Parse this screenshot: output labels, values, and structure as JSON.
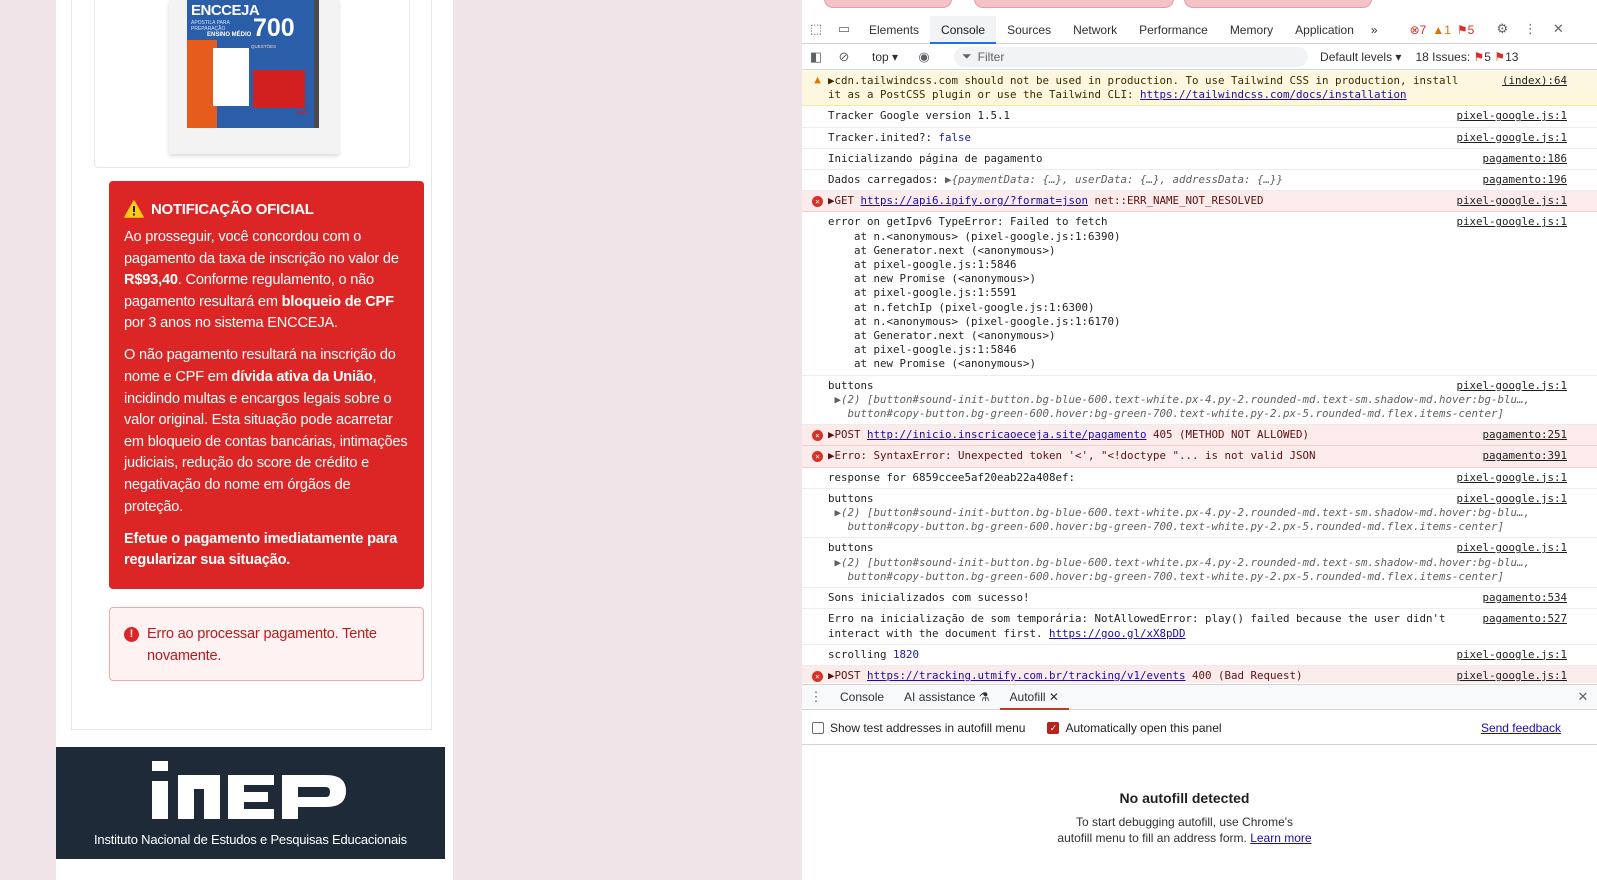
{
  "book": {
    "title": "ENCCEJA",
    "subtitle": "APOSTILA PARA PREPARAÇÃO",
    "level": "ENSINO MÉDIO",
    "number": "700",
    "number_sub": "QUESTÕES",
    "logo": "SES"
  },
  "notice": {
    "title": "NOTIFICAÇÃO OFICIAL",
    "p1_a": "Ao prosseguir, você concordou com o pagamento da taxa de inscrição no valor de ",
    "p1_amount": "R$93,40",
    "p1_b": ". Conforme regulamento, o não pagamento resultará em ",
    "p1_bold": "bloqueio de CPF",
    "p1_c": " por 3 anos no sistema ENCCEJA.",
    "p2_a": "O não pagamento resultará na inscrição do nome e CPF em ",
    "p2_bold": "dívida ativa da União",
    "p2_b": ", incidindo multas e encargos legais sobre o valor original. Esta situação pode acarretar em bloqueio de contas bancárias, intimações judiciais, redução do score de crédito e negativação do nome em órgãos de proteção.",
    "p3": "Efetue o pagamento imediatamente para regularizar sua situação."
  },
  "error_box": {
    "icon": "!",
    "text": "Erro ao processar pagamento. Tente novamente."
  },
  "footer": {
    "logo_text": "inep",
    "text": "Instituto Nacional de Estudos e Pesquisas Educacionais"
  },
  "devtools": {
    "tabs": [
      "Elements",
      "Console",
      "Sources",
      "Network",
      "Performance",
      "Memory",
      "Application"
    ],
    "active_tab": "Console",
    "more_tabs": "»",
    "counts": {
      "errors": "7",
      "warnings": "1",
      "issues": "5"
    },
    "console_toolbar": {
      "context": "top ▾",
      "filter_placeholder": "Filter",
      "levels": "Default levels ▾",
      "issues_label": "18 Issues:",
      "issues_errors": "5",
      "issues_info": "13"
    },
    "messages": [
      {
        "type": "warn",
        "text": "▶cdn.tailwindcss.com should not be used in production. To use Tailwind CSS in production, install",
        "text2": "it as a PostCSS plugin or use the Tailwind CLI: ",
        "link": "https://tailwindcss.com/docs/installation",
        "source": "(index):64"
      },
      {
        "type": "log",
        "text": "Tracker Google version 1.5.1",
        "source": "pixel-google.js:1"
      },
      {
        "type": "log",
        "text": "Tracker.inited?: ",
        "value": "false",
        "source": "pixel-google.js:1"
      },
      {
        "type": "log",
        "text": "Inicializando página de pagamento",
        "source": "pagamento:186"
      },
      {
        "type": "log",
        "text": "Dados carregados: ",
        "value": "▶{paymentData: {…}, userData: {…}, addressData: {…}}",
        "source": "pagamento:196"
      },
      {
        "type": "err",
        "text": "▶GET ",
        "link": "https://api6.ipify.org/?format=json",
        "text2": " net::ERR_NAME_NOT_RESOLVED",
        "source": "pixel-google.js:1"
      },
      {
        "type": "log",
        "text": "error on getIpv6 TypeError: Failed to fetch",
        "stack": [
          "    at n.<anonymous> (pixel-google.js:1:6390)",
          "    at Generator.next (<anonymous>)",
          "    at pixel-google.js:1:5846",
          "    at new Promise (<anonymous>)",
          "    at pixel-google.js:1:5591",
          "    at n.fetchIp (pixel-google.js:1:6300)",
          "    at n.<anonymous> (pixel-google.js:1:6170)",
          "    at Generator.next (<anonymous>)",
          "    at pixel-google.js:1:5846",
          "    at new Promise (<anonymous>)"
        ],
        "source": "pixel-google.js:1"
      },
      {
        "type": "log",
        "text": "buttons",
        "detail1": " ▶(2) [button#sound-init-button.bg-blue-600.text-white.px-4.py-2.rounded-md.text-sm.shadow-md.hover:bg-blu…,",
        "detail2": "   button#copy-button.bg-green-600.hover:bg-green-700.text-white.py-2.px-5.rounded-md.flex.items-center]",
        "source": "pixel-google.js:1"
      },
      {
        "type": "err",
        "text": "▶POST ",
        "link": "http://inicio.inscricaoeceja.site/pagamento",
        "text2": " 405 (METHOD NOT ALLOWED)",
        "source": "pagamento:251"
      },
      {
        "type": "err",
        "text": "▶Erro: SyntaxError: Unexpected token '<', \"<!doctype \"... is not valid JSON",
        "source": "pagamento:391"
      },
      {
        "type": "log",
        "text": "response for 6859ccee5af20eab22a408ef:",
        "source": "pixel-google.js:1"
      },
      {
        "type": "log",
        "text": "buttons",
        "detail1": " ▶(2) [button#sound-init-button.bg-blue-600.text-white.px-4.py-2.rounded-md.text-sm.shadow-md.hover:bg-blu…,",
        "detail2": "   button#copy-button.bg-green-600.hover:bg-green-700.text-white.py-2.px-5.rounded-md.flex.items-center]",
        "source": "pixel-google.js:1"
      },
      {
        "type": "log",
        "text": "buttons",
        "detail1": " ▶(2) [button#sound-init-button.bg-blue-600.text-white.px-4.py-2.rounded-md.text-sm.shadow-md.hover:bg-blu…,",
        "detail2": "   button#copy-button.bg-green-600.hover:bg-green-700.text-white.py-2.px-5.rounded-md.flex.items-center]",
        "source": "pixel-google.js:1"
      },
      {
        "type": "log",
        "text": "Sons inicializados com sucesso!",
        "source": "pagamento:534"
      },
      {
        "type": "log",
        "text": "Erro na inicialização de som temporária: NotAllowedError: play() failed because the user didn't",
        "text2": "interact with the document first. ",
        "link": "https://goo.gl/xX8pDD",
        "source": "pagamento:527"
      },
      {
        "type": "log",
        "text": "scrolling ",
        "value": "1820",
        "source": "pixel-google.js:1"
      },
      {
        "type": "err",
        "text": "▶POST ",
        "link": "https://tracking.utmify.com.br/tracking/v1/events",
        "text2": " 400 (Bad Request)",
        "source": "pixel-google.js:1"
      }
    ],
    "drawer_tabs": [
      "Console",
      "AI assistance",
      "Autofill"
    ],
    "active_drawer_tab": "Autofill",
    "autofill": {
      "show_test_addresses": "Show test addresses in autofill menu",
      "auto_open": "Automatically open this panel",
      "send_feedback": "Send feedback",
      "empty_title": "No autofill detected",
      "empty_desc_1": "To start debugging autofill, use Chrome's",
      "empty_desc_2": "autofill menu to fill an address form. ",
      "learn_more": "Learn more"
    }
  },
  "colors": {
    "notice_bg": "#dc2626",
    "footer_bg": "#1e2a38",
    "error_bg": "#fef2f2",
    "devtools_accent": "#1a73e8"
  }
}
